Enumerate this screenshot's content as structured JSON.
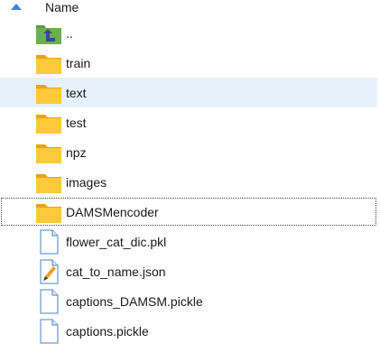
{
  "header": {
    "name_label": "Name",
    "sort": "ascending"
  },
  "items": [
    {
      "label": "..",
      "type": "parent-folder",
      "icon": "up-folder-icon"
    },
    {
      "label": "train",
      "type": "folder",
      "icon": "folder-icon"
    },
    {
      "label": "text",
      "type": "folder",
      "icon": "folder-icon",
      "selected": true
    },
    {
      "label": "test",
      "type": "folder",
      "icon": "folder-icon"
    },
    {
      "label": "npz",
      "type": "folder",
      "icon": "folder-icon"
    },
    {
      "label": "images",
      "type": "folder",
      "icon": "folder-icon"
    },
    {
      "label": "DAMSMencoder",
      "type": "folder",
      "icon": "folder-icon",
      "focused": true
    },
    {
      "label": "flower_cat_dic.pkl",
      "type": "file",
      "icon": "file-icon"
    },
    {
      "label": "cat_to_name.json",
      "type": "file",
      "icon": "json-file-icon"
    },
    {
      "label": "captions_DAMSM.pickle",
      "type": "file",
      "icon": "file-icon"
    },
    {
      "label": "captions.pickle",
      "type": "file",
      "icon": "file-icon"
    }
  ],
  "colors": {
    "selection": "#e5f1fb",
    "folder": "#ffc83d",
    "up_folder": "#6ab04c",
    "sort_arrow": "#3a86d6"
  }
}
